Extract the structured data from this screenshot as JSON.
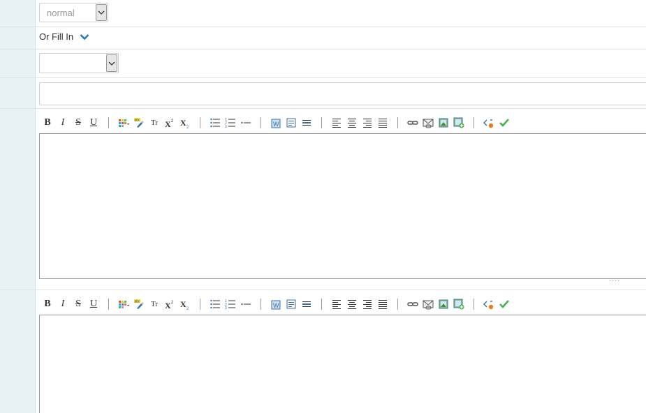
{
  "size_select": {
    "value": "normal"
  },
  "fill_in": {
    "label": "Or Fill In"
  },
  "second_select": {
    "value": ""
  },
  "text_field": {
    "value": ""
  },
  "editor_toolbar": {
    "buttons": [
      "B",
      "I",
      "S",
      "U",
      "Tr",
      "X",
      "X"
    ]
  },
  "editor1": {
    "content": ""
  },
  "editor2": {
    "content": ""
  },
  "colors": {
    "sidebar": "#e8f1f5",
    "accent_blue": "#2a7ab8",
    "border": "#cfcfcf"
  }
}
